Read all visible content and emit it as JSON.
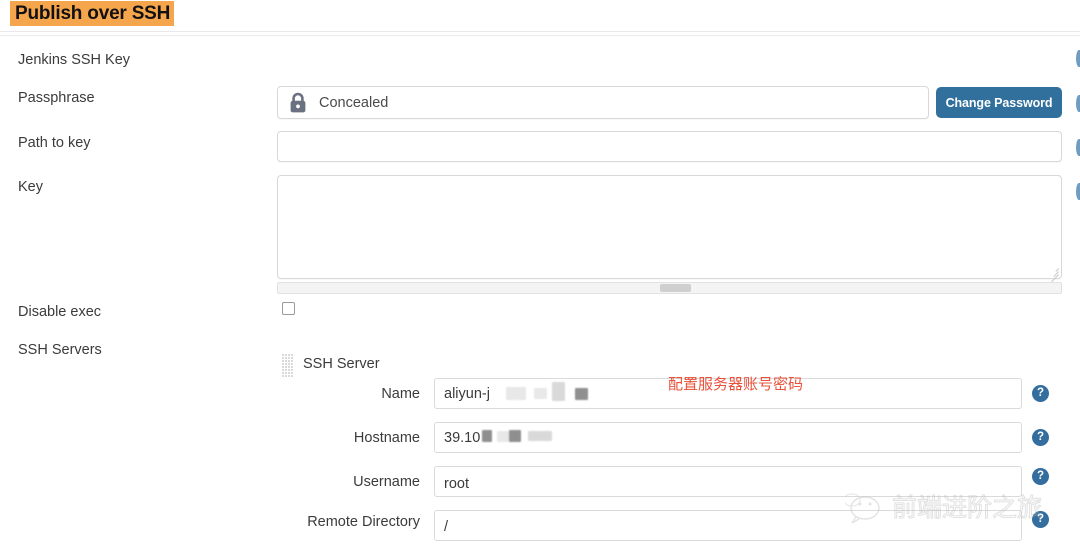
{
  "section": {
    "title": "Publish over SSH"
  },
  "form": {
    "jenkins_ssh_key_label": "Jenkins SSH Key",
    "passphrase_label": "Passphrase",
    "passphrase_value": "Concealed",
    "change_password_label": "Change Password",
    "path_to_key_label": "Path to key",
    "path_to_key_value": "",
    "key_label": "Key",
    "key_value": "",
    "disable_exec_label": "Disable exec",
    "disable_exec_checked": false,
    "ssh_servers_label": "SSH Servers"
  },
  "ssh_server": {
    "heading": "SSH Server",
    "fields": [
      {
        "label": "Name",
        "value": "aliyun-j",
        "redacted": true
      },
      {
        "label": "Hostname",
        "value": "39.10",
        "redacted": true
      },
      {
        "label": "Username",
        "value": "root",
        "redacted": false
      },
      {
        "label": "Remote Directory",
        "value": "/",
        "redacted": false
      }
    ]
  },
  "help": {
    "glyph": "?"
  },
  "annotation": {
    "text": "配置服务器账号密码",
    "color": "#e8513a"
  },
  "watermark": {
    "text": "前端进阶之旅"
  },
  "colors": {
    "title_highlight": "#f5a54c",
    "button_blue": "#31709d",
    "help_icon_blue": "#336e9f"
  }
}
